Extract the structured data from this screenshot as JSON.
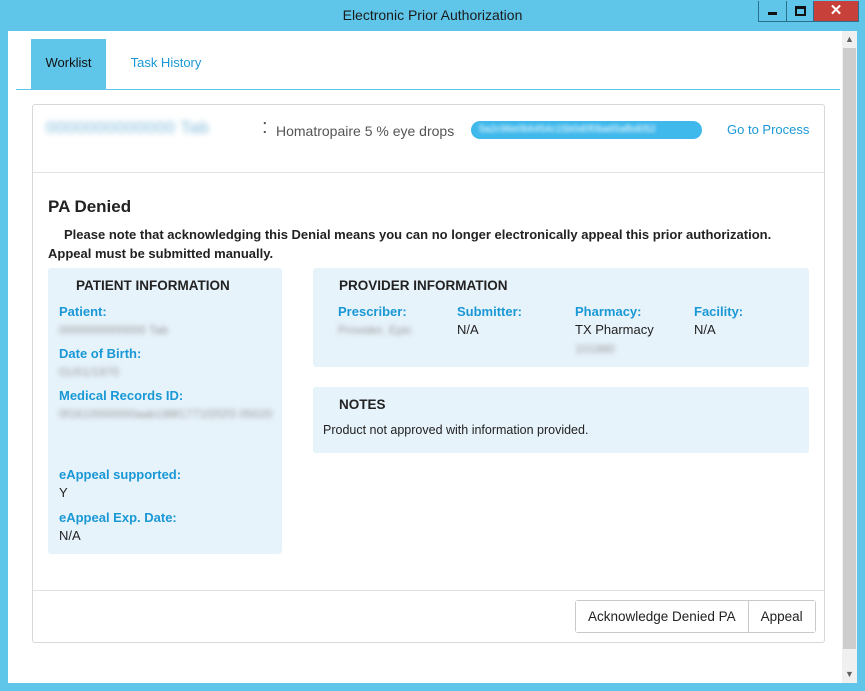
{
  "window": {
    "title": "Electronic Prior Authorization",
    "controls": {
      "minimize": "minimize-icon",
      "maximize": "maximize-icon",
      "close": "close-icon"
    }
  },
  "tabs": [
    {
      "label": "Worklist",
      "active": true
    },
    {
      "label": "Task History",
      "active": false
    }
  ],
  "header": {
    "patient_id_masked": "0000000000000 Tab",
    "separator": ":",
    "drug": "Homatropaire 5 % eye drops",
    "request_id_masked": "5a2c96e0b6454c15b0d0f0ba65afbd052",
    "go_to_process": "Go to Process"
  },
  "status": {
    "title": "PA Denied",
    "notice": "Please note that acknowledging this Denial means you can no longer electronically appeal this prior authorization. Appeal must be submitted manually."
  },
  "patient_info": {
    "title": "PATIENT INFORMATION",
    "patient_label": "Patient:",
    "patient_value_masked": "0000000000000 Tab",
    "dob_label": "Date of Birth:",
    "dob_value_masked": "01/01/1970",
    "mrn_label": "Medical Records ID:",
    "mrn_value_masked": "0f1610000000aab188f1771f2f2f3 05020",
    "eappeal_label": "eAppeal supported:",
    "eappeal_value": "Y",
    "eappeal_exp_label": "eAppeal Exp. Date:",
    "eappeal_exp_value": "N/A"
  },
  "provider_info": {
    "title": "PROVIDER INFORMATION",
    "prescriber_label": "Prescriber:",
    "prescriber_value_masked": "Provider, Epic",
    "submitter_label": "Submitter:",
    "submitter_value": "N/A",
    "pharmacy_label": "Pharmacy:",
    "pharmacy_value": "TX Pharmacy",
    "pharmacy_id_masked": "101880",
    "facility_label": "Facility:",
    "facility_value": "N/A"
  },
  "notes": {
    "title": "NOTES",
    "text": "Product not approved with information provided."
  },
  "actions": {
    "acknowledge": "Acknowledge Denied PA",
    "appeal": "Appeal"
  },
  "colors": {
    "window_frame": "#5fc6ea",
    "accent": "#1a98d5",
    "card_bg": "#e7f3fb",
    "close_button": "#c7403a"
  }
}
